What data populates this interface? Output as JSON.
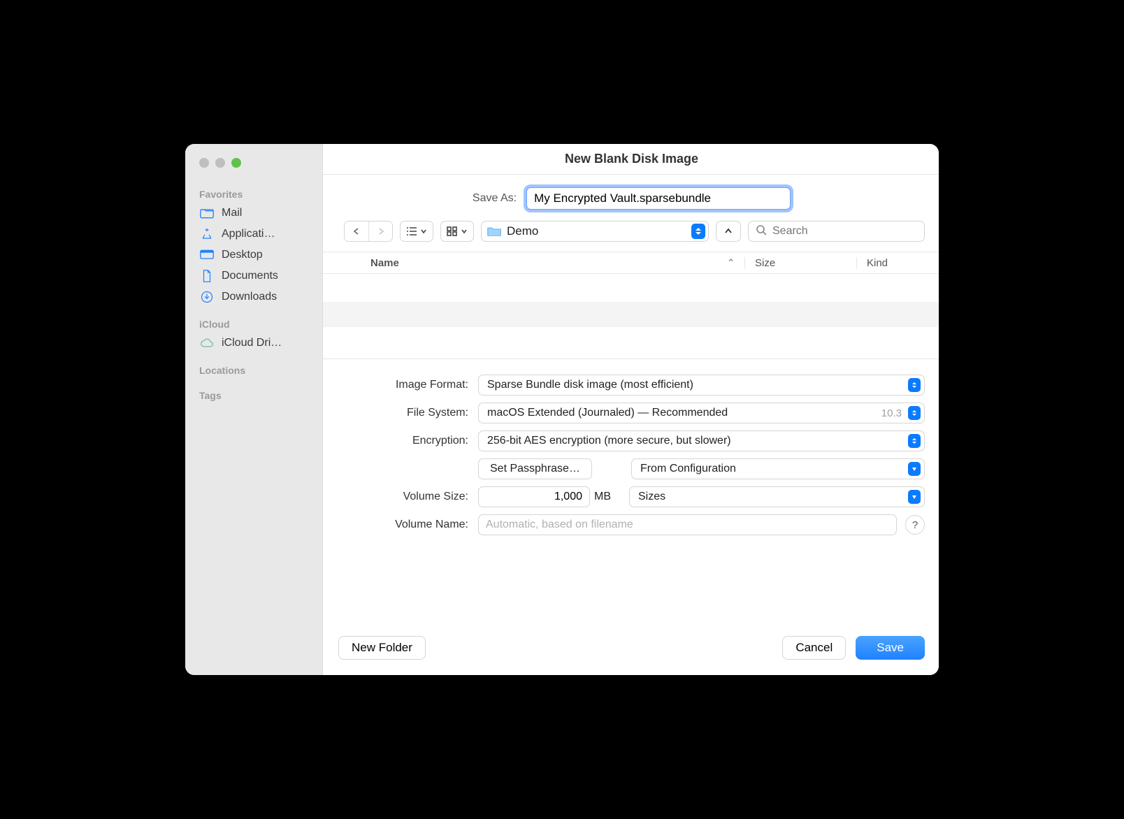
{
  "window": {
    "title": "New Blank Disk Image"
  },
  "save_as": {
    "label": "Save As:",
    "value": "My Encrypted Vault.sparsebundle"
  },
  "toolbar": {
    "location": "Demo",
    "search_placeholder": "Search"
  },
  "columns": {
    "name": "Name",
    "size": "Size",
    "kind": "Kind"
  },
  "sidebar": {
    "favorites_header": "Favorites",
    "favorites": [
      {
        "label": "Mail"
      },
      {
        "label": "Applicati…"
      },
      {
        "label": "Desktop"
      },
      {
        "label": "Documents"
      },
      {
        "label": "Downloads"
      }
    ],
    "icloud_header": "iCloud",
    "icloud": [
      {
        "label": "iCloud Dri…"
      }
    ],
    "locations_header": "Locations",
    "tags_header": "Tags"
  },
  "form": {
    "image_format": {
      "label": "Image Format:",
      "value": "Sparse Bundle disk image (most efficient)"
    },
    "file_system": {
      "label": "File System:",
      "value": "macOS Extended (Journaled) — Recommended",
      "hint": "10.3"
    },
    "encryption": {
      "label": "Encryption:",
      "value": "256-bit AES encryption (more secure, but slower)"
    },
    "passphrase_btn": "Set Passphrase…",
    "passphrase_src": "From Configuration",
    "volume_size": {
      "label": "Volume Size:",
      "value": "1,000",
      "unit": "MB",
      "sizes": "Sizes"
    },
    "volume_name": {
      "label": "Volume Name:",
      "placeholder": "Automatic, based on filename"
    }
  },
  "footer": {
    "new_folder": "New Folder",
    "cancel": "Cancel",
    "save": "Save"
  }
}
